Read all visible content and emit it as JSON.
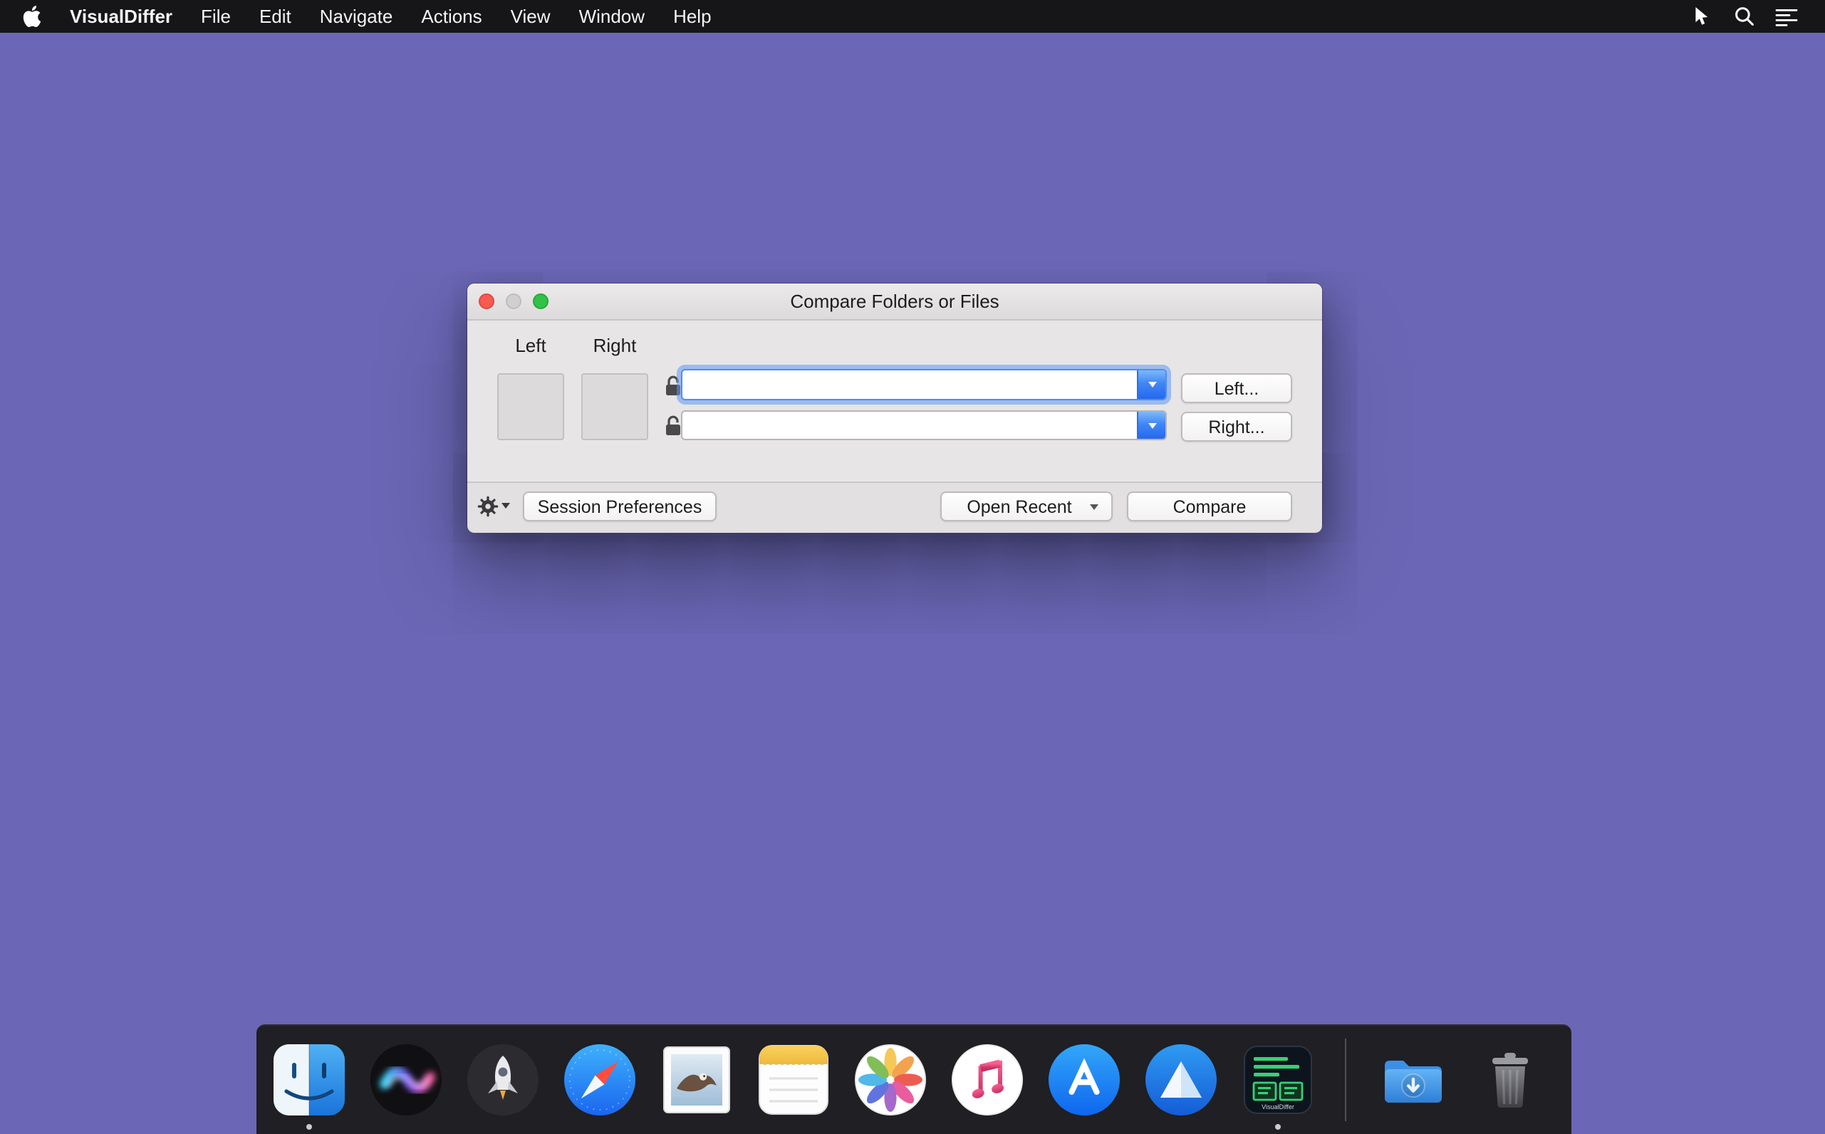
{
  "menu_bar": {
    "app_name": "VisualDiffer",
    "items": [
      {
        "label": "File"
      },
      {
        "label": "Edit"
      },
      {
        "label": "Navigate"
      },
      {
        "label": "Actions"
      },
      {
        "label": "View"
      },
      {
        "label": "Window"
      },
      {
        "label": "Help"
      }
    ]
  },
  "dialog": {
    "title": "Compare Folders or Files",
    "left_column_label": "Left",
    "right_column_label": "Right",
    "left_path": {
      "value": ""
    },
    "right_path": {
      "value": ""
    },
    "left_button": "Left...",
    "right_button": "Right...",
    "session_preferences_button": "Session Preferences",
    "open_recent_button": "Open Recent",
    "compare_button": "Compare"
  },
  "dock": {
    "items": [
      {
        "name": "finder"
      },
      {
        "name": "siri"
      },
      {
        "name": "launchpad"
      },
      {
        "name": "safari"
      },
      {
        "name": "mail"
      },
      {
        "name": "notes"
      },
      {
        "name": "photos"
      },
      {
        "name": "itunes"
      },
      {
        "name": "app-store"
      },
      {
        "name": "blue-triangle-app"
      },
      {
        "name": "visualdiffer"
      },
      {
        "name": "downloads"
      },
      {
        "name": "trash"
      }
    ]
  },
  "colors": {
    "desktop": "#6b67b6",
    "menubar": "#161618",
    "focus_blue": "#4c8ef5",
    "combo_arrow_top": "#7db9fc",
    "combo_arrow_bottom": "#2469ee",
    "traffic_close": "#f95a52",
    "traffic_minimize_disabled": "#d2d0cf",
    "traffic_zoom": "#31c247"
  }
}
